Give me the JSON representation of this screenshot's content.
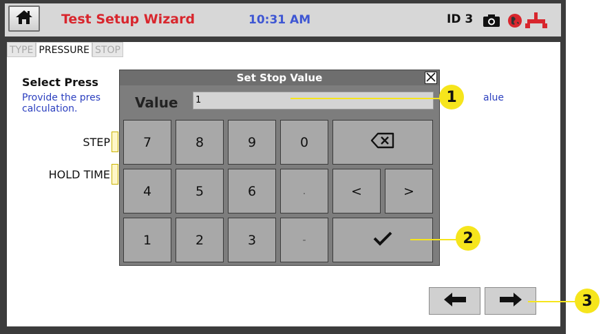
{
  "header": {
    "home_icon": "home-icon",
    "title": "Test Setup Wizard",
    "time": "10:31 AM",
    "device_id": "ID 3",
    "status_icons": [
      "camera-icon",
      "globe-icon",
      "usb-icon"
    ]
  },
  "tabs": [
    {
      "label": "TYPE",
      "active": false
    },
    {
      "label": "PRESSURE",
      "active": true
    },
    {
      "label": "STOP",
      "active": false
    }
  ],
  "main": {
    "section_title": "Select Press",
    "description_line1_left": "Provide the pres",
    "description_line1_right": "alue",
    "description_line2": "calculation.",
    "fields": [
      {
        "label": "STEP"
      },
      {
        "label": "HOLD TIME"
      }
    ]
  },
  "dialog": {
    "title": "Set Stop Value",
    "value_label": "Value",
    "value": "1",
    "keys": {
      "k7": "7",
      "k8": "8",
      "k9": "9",
      "k0": "0",
      "k4": "4",
      "k5": "5",
      "k6": "6",
      "dot": ".",
      "left": "<",
      "right": ">",
      "k1": "1",
      "k2": "2",
      "k3": "3",
      "minus": "-"
    },
    "icons": [
      "close-icon",
      "backspace-icon",
      "checkmark-icon"
    ]
  },
  "navigation": {
    "back_icon": "arrow-left-icon",
    "next_icon": "arrow-right-icon"
  },
  "callouts": [
    "1",
    "2",
    "3"
  ],
  "colors": {
    "title_red": "#d8262d",
    "clock_blue": "#3e56d3",
    "callout_yellow": "#f6e51c",
    "description_blue": "#2b3fbf"
  }
}
